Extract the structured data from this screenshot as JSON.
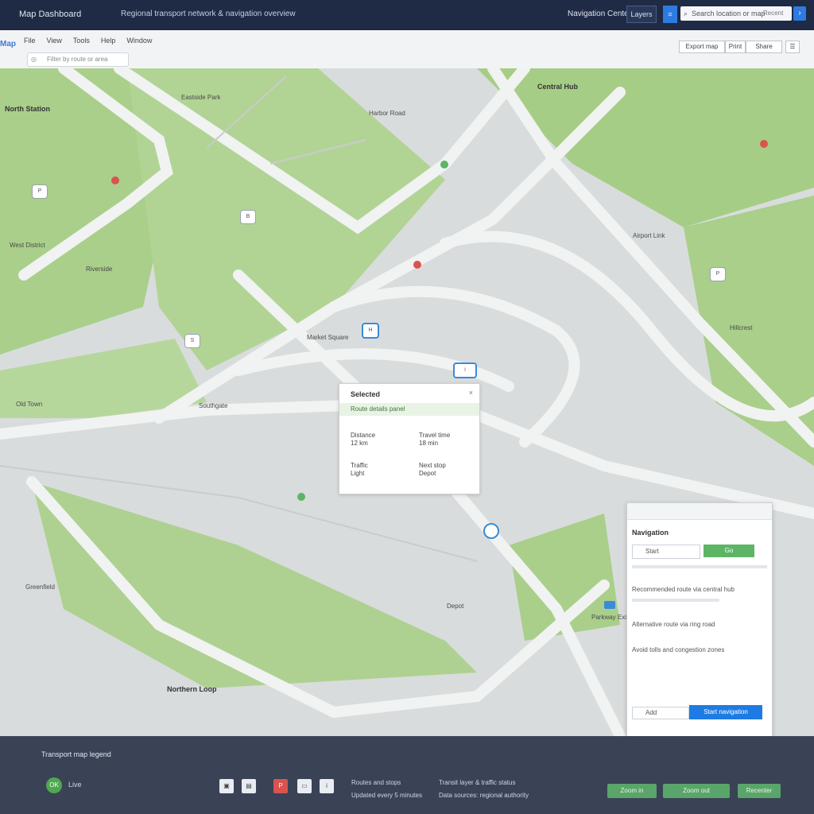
{
  "header": {
    "brand": "Map Dashboard",
    "subtitle": "Regional transport network & navigation overview",
    "user": "Navigation Center",
    "btn1": "Layers",
    "search_placeholder": "Search location or map",
    "search_value": "Recent"
  },
  "toolbar": {
    "logo": "Map",
    "menu": [
      "File",
      "View",
      "Tools",
      "Help",
      "Window"
    ],
    "filter_placeholder": "Filter by route or area",
    "right1": "Export map",
    "right2": "Print",
    "right3": "Share"
  },
  "map": {
    "labels": [
      "North Station",
      "Eastside Park",
      "Harbor Road",
      "Central Hub",
      "West District",
      "Riverside",
      "Market Square",
      "Old Town",
      "Airport Link",
      "Southgate",
      "Hillcrest",
      "Greenfield",
      "Parkway Exit",
      "Northern Loop",
      "Depot"
    ],
    "markers": [
      "P",
      "B",
      "H",
      "i",
      "S",
      "P"
    ]
  },
  "popup": {
    "title": "Selected",
    "subtitle": "Route details panel",
    "c1": "Distance",
    "c1v": "12 km",
    "c2": "Travel time",
    "c2v": "18 min",
    "c3": "Traffic",
    "c3v": "Light",
    "c4": "Next stop",
    "c4v": "Depot"
  },
  "panel": {
    "title": "Navigation",
    "input": "Start",
    "go": "Go",
    "row1": "Recommended route via central hub",
    "row2": "Alternative route via ring road",
    "row3": "Avoid tolls and congestion zones",
    "ask": "Add",
    "submit": "Start navigation"
  },
  "footer": {
    "title": "Transport map  legend",
    "badge": "OK",
    "badge_value": "Live",
    "t1": "Routes and stops",
    "t2": "Updated every 5 minutes",
    "t3": "Transit layer & traffic status",
    "t4": "Data sources: regional authority",
    "btn1": "Zoom in",
    "btn2": "Zoom out",
    "btn3": "Recenter"
  }
}
